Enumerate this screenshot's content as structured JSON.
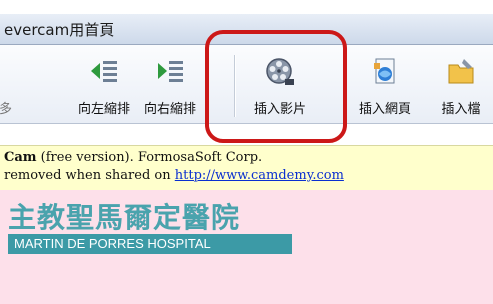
{
  "window": {
    "title": "evercam用首頁"
  },
  "toolbar": {
    "left_partial_label": "多",
    "buttons": [
      {
        "label": "向左縮排",
        "icon": "outdent-left-icon"
      },
      {
        "label": "向右縮排",
        "icon": "indent-right-icon"
      },
      {
        "label": "插入影片",
        "icon": "film-reel-icon"
      },
      {
        "label": "插入網頁",
        "icon": "insert-webpage-icon"
      },
      {
        "label": "插入檔",
        "icon": "insert-file-icon"
      }
    ]
  },
  "notice": {
    "brand": "Cam",
    "line1_rest": " (free version). FormosaSoft Corp.",
    "line2_text": " removed when shared on ",
    "link": "http://www.camdemy.com"
  },
  "page": {
    "logo_cn": "主教聖馬爾定醫院",
    "logo_en": "MARTIN DE PORRES HOSPITAL"
  },
  "colors": {
    "highlight": "#cc1818",
    "notice_bg": "#ffffcc",
    "page_bg": "#fde0ea",
    "logo": "#3c9aa6"
  }
}
